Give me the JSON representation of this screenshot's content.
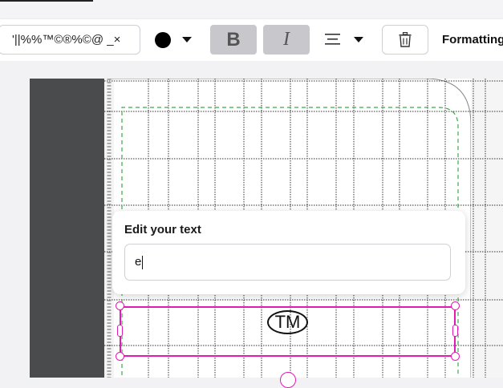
{
  "toolbar": {
    "symbol_text": "'||%%™©®%©@ _×",
    "color": "#000000",
    "bold_label": "B",
    "italic_label": "I",
    "formatting_label": "Formatting"
  },
  "popup": {
    "title": "Edit your text",
    "input_value": "e"
  },
  "text_element": {
    "content": "TM"
  },
  "colors": {
    "selection": "#e31bb6",
    "guide": "#3aaa4a",
    "panel": "#4a4b4d"
  }
}
